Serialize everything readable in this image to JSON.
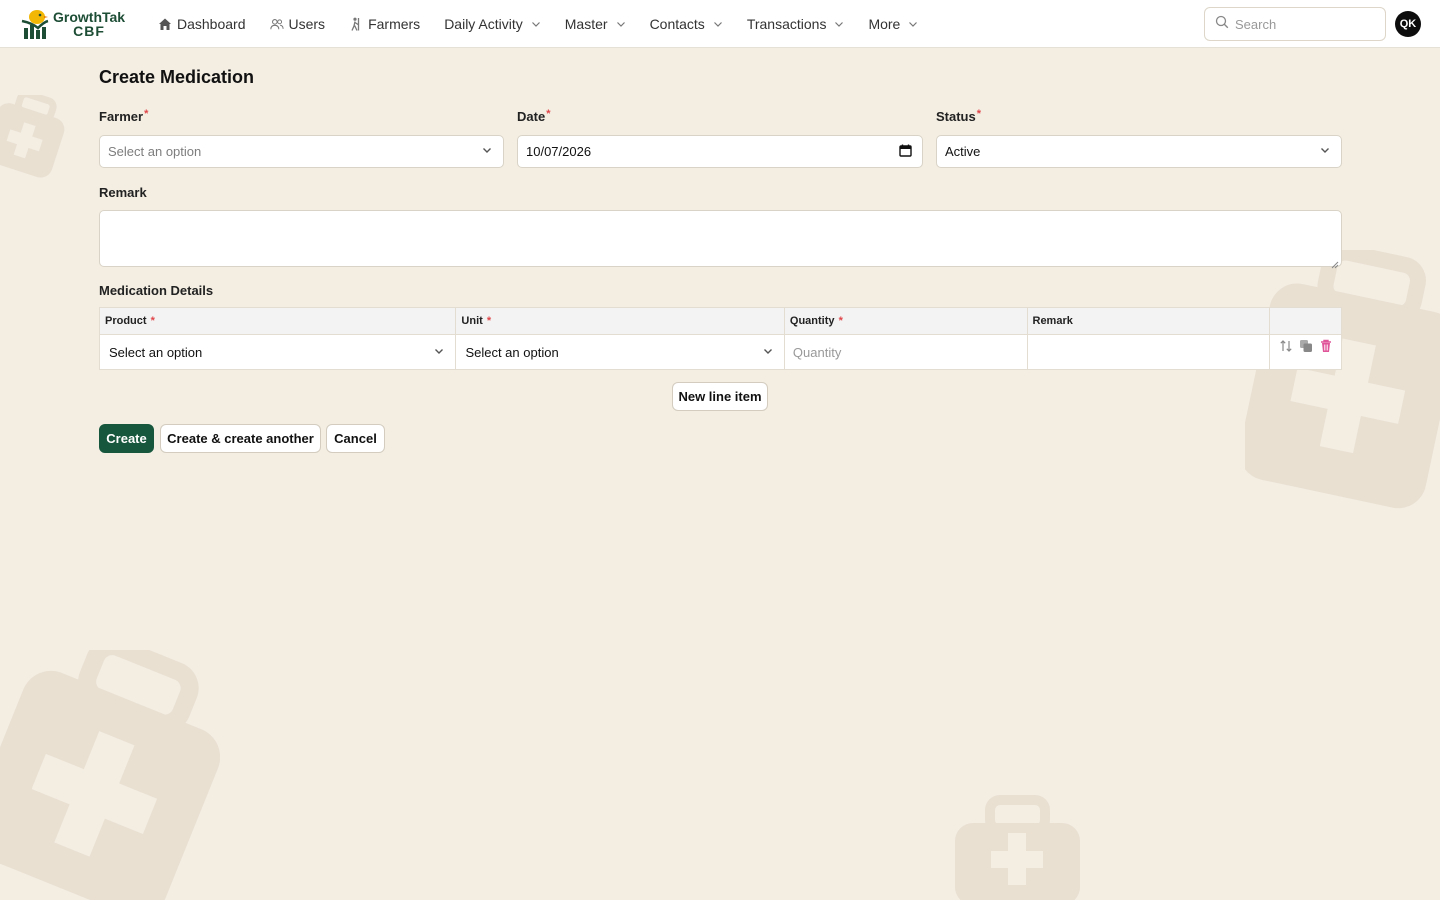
{
  "app": {
    "brand_name": "GrowthTak",
    "brand_sub": "CBF"
  },
  "nav": {
    "items": [
      {
        "label": "Dashboard",
        "icon": "home-icon",
        "dropdown": false
      },
      {
        "label": "Users",
        "icon": "users-icon",
        "dropdown": false
      },
      {
        "label": "Farmers",
        "icon": "farmer-icon",
        "dropdown": false
      },
      {
        "label": "Daily Activity",
        "icon": "",
        "dropdown": true
      },
      {
        "label": "Master",
        "icon": "",
        "dropdown": true
      },
      {
        "label": "Contacts",
        "icon": "",
        "dropdown": true
      },
      {
        "label": "Transactions",
        "icon": "",
        "dropdown": true
      },
      {
        "label": "More",
        "icon": "",
        "dropdown": true
      }
    ]
  },
  "search": {
    "placeholder": "Search"
  },
  "user": {
    "initials": "QK"
  },
  "page": {
    "title": "Create Medication"
  },
  "form": {
    "farmer": {
      "label": "Farmer",
      "placeholder": "Select an option"
    },
    "date": {
      "label": "Date",
      "value": "10/07/2026"
    },
    "status": {
      "label": "Status",
      "value": "Active"
    },
    "remark": {
      "label": "Remark",
      "value": ""
    }
  },
  "details": {
    "title": "Medication Details",
    "columns": [
      "Product",
      "Unit",
      "Quantity",
      "Remark"
    ],
    "row": {
      "product": "Select an option",
      "unit": "Select an option",
      "quantity_placeholder": "Quantity",
      "remark": ""
    },
    "new_line_label": "New line item"
  },
  "buttons": {
    "create": "Create",
    "create_another": "Create & create another",
    "cancel": "Cancel"
  },
  "colors": {
    "background": "#f3ede2",
    "primary": "#17573d",
    "required": "#e0464a",
    "delete": "#e0559a"
  }
}
